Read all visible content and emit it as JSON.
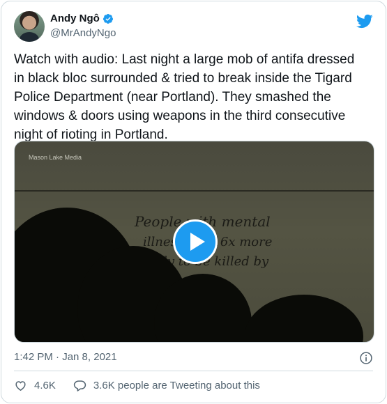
{
  "author": {
    "display_name": "Andy Ngô",
    "handle": "@MrAndyNgo"
  },
  "tweet": {
    "text": "Watch with audio: Last night a large mob of antifa dressed in black bloc surrounded & tried to break inside the Tigard Police Department (near Portland). They smashed the windows & doors using weapons in the third consecutive night of rioting in Portland.",
    "timestamp": "1:42 PM · Jan 8, 2021"
  },
  "media": {
    "watermark": "Mason Lake Media",
    "graffiti_lines": [
      "People with mental",
      "illness are 16x more",
      "likely to be killed by"
    ]
  },
  "actions": {
    "like_count": "4.6K",
    "reply_label": "3.6K people are Tweeting about this"
  },
  "colors": {
    "accent": "#1d9bf0",
    "text_secondary": "#536471",
    "border": "#cfd9de"
  },
  "icons": {
    "verified": "verified-badge-icon",
    "logo": "twitter-bird-icon",
    "play": "play-icon",
    "info": "info-icon",
    "like": "heart-icon",
    "reply": "speech-bubble-icon"
  }
}
